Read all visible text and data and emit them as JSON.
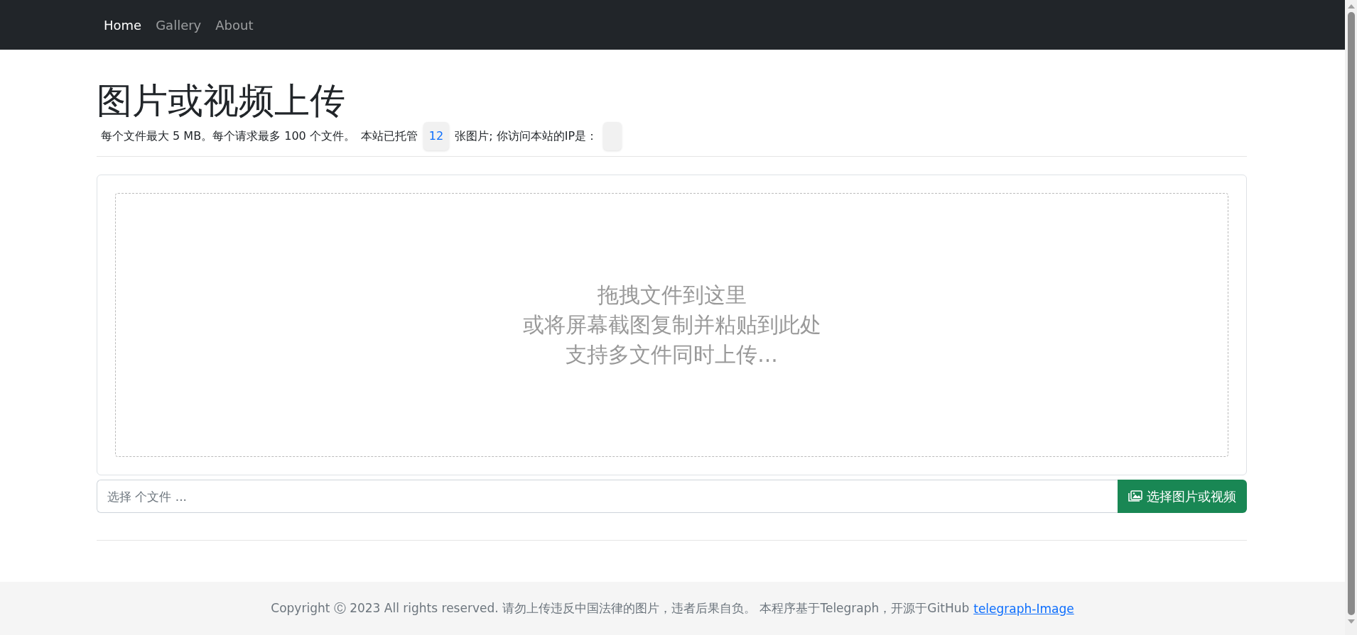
{
  "nav": [
    {
      "label": "Home",
      "selected": true
    },
    {
      "label": "Gallery",
      "selected": false
    },
    {
      "label": "About",
      "selected": false
    }
  ],
  "title": "图片或视频上传",
  "subtitle": {
    "limits": "每个文件最大 5 MB。每个请求最多 100 个文件。",
    "hosted_prefix": "本站已托管",
    "hosted_count": "12",
    "hosted_suffix": "张图片; 你访问本站的IP是："
  },
  "dropzone": {
    "lines": [
      "拖拽文件到这里",
      "或将屏幕截图复制并粘贴到此处",
      "支持多文件同时上传..."
    ]
  },
  "file_input": {
    "placeholder": "选择 个文件 ...",
    "button": "选择图片或视频"
  },
  "footer": {
    "text": "Copyright Ⓒ 2023 All rights reserved. 请勿上传违反中国法律的图片，违者后果自负。 本程序基于Telegraph，开源于GitHub",
    "link": "telegraph-Image"
  }
}
